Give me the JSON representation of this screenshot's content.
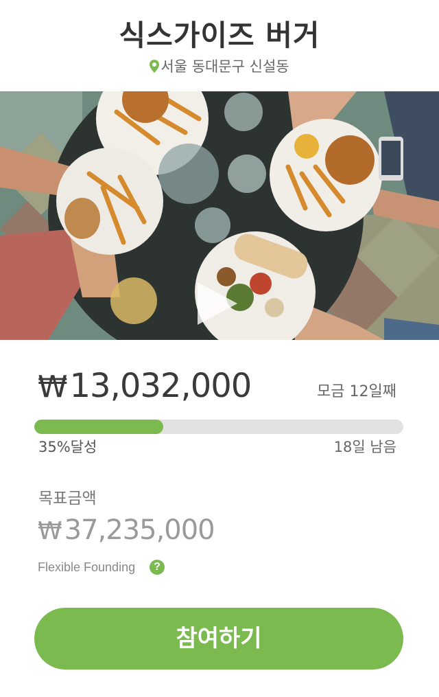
{
  "header": {
    "title": "식스가이즈 버거",
    "location": "서울 동대문구 신설동",
    "location_icon": "map-pin-icon"
  },
  "hero": {
    "image_subject": "burger-and-fries-table",
    "play_icon": "play-icon"
  },
  "funding": {
    "currency_symbol": "₩",
    "raised_amount": "13,032,000",
    "day_count": "모금 12일째",
    "progress_percent": 35,
    "percent_label": "35%달성",
    "remaining_label": "18일 남음",
    "goal_label": "목표금액",
    "goal_amount": "37,235,000",
    "funding_type": "Flexible Founding",
    "help_icon_glyph": "?"
  },
  "cta": {
    "join_label": "참여하기"
  },
  "colors": {
    "accent": "#7aba4f",
    "track": "#e2e2e2",
    "text_dark": "#333333",
    "text_muted": "#9a9a9a"
  }
}
